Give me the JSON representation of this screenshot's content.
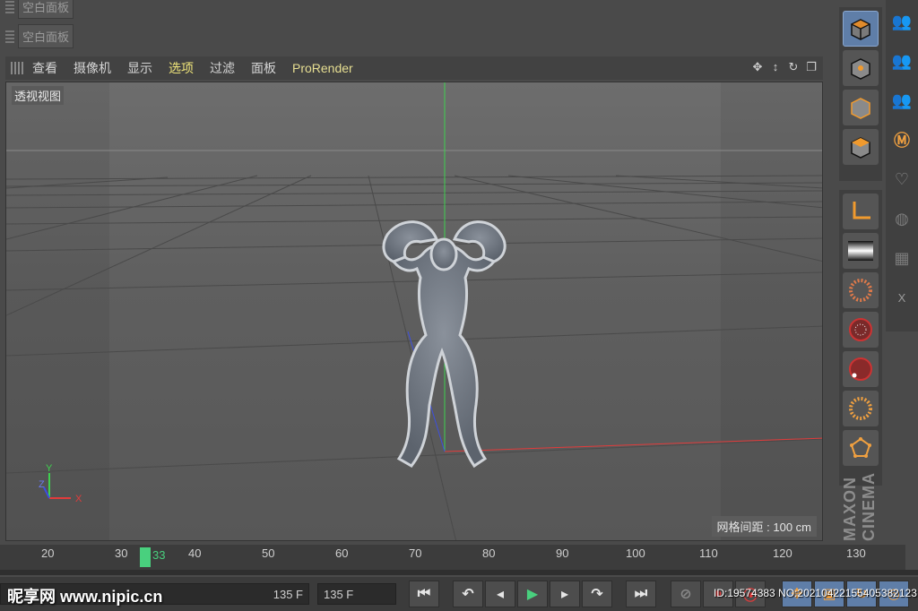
{
  "panels": {
    "empty_label_1": "空白面板",
    "empty_label_2": "空白面板"
  },
  "viewport_menu": {
    "items": [
      "查看",
      "摄像机",
      "显示",
      "选项",
      "过滤",
      "面板",
      "ProRender"
    ],
    "active_index": 3
  },
  "viewport": {
    "name": "透视视图",
    "grid_spacing": "网格间距 : 100 cm",
    "axis_y": "Y",
    "axis_z": "Z",
    "axis_x": "X"
  },
  "timeline": {
    "ticks": [
      "20",
      "30",
      "40",
      "50",
      "60",
      "70",
      "80",
      "90",
      "100",
      "110",
      "120",
      "130"
    ],
    "current_frame": "33"
  },
  "transport": {
    "start_frame_suffix": "135 F",
    "end_frame": "135 F"
  },
  "brand": {
    "vertical_text": "MAXON CINEMA"
  },
  "right_toolbar_icons": [
    "cube-icon",
    "cube-points-icon",
    "cube-edges-icon",
    "cube-polygons-icon",
    "axis-icon",
    "gradient-icon",
    "dynamics-burst-icon",
    "radial-red-icon",
    "radial-dot-icon",
    "dynamics-orange-icon",
    "polygon-pentagon-icon"
  ],
  "watermark": {
    "site": "昵享网 www.nipic.cn",
    "id": "ID:19574383 NO:20210422155405382123"
  },
  "colors": {
    "accent_active": "#f0e57a",
    "playhead": "#49d07e",
    "x_axis": "#e23b3b",
    "y_axis": "#3fd14f",
    "z_axis": "#3d4fe0",
    "selected_tool": "#5f7ea8"
  }
}
